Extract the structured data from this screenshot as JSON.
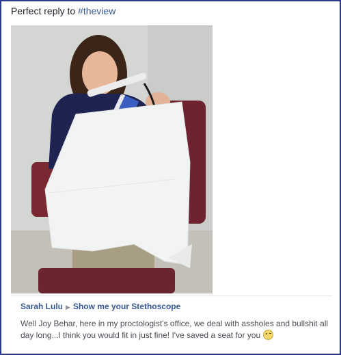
{
  "post": {
    "text_prefix": "Perfect reply to ",
    "hashtag": "#theview"
  },
  "shared": {
    "author": "Sarah Lulu",
    "group": "Show me your Stethoscope",
    "comment": "Well Joy Behar, here in my proctologist's office, we deal with assholes and bullshit all day long...I think you would fit in just fine! I've saved a seat for you",
    "emoji": "wink-emoji"
  },
  "colors": {
    "frame_border": "#2c3a8c",
    "link": "#365899",
    "text": "#4b4f56"
  }
}
